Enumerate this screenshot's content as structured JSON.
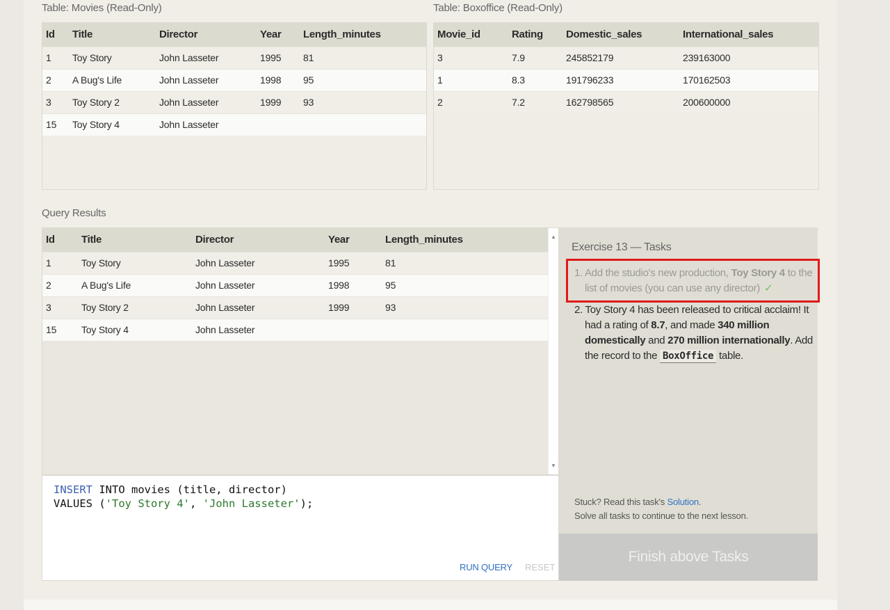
{
  "movies_table": {
    "caption": "Table: Movies (Read-Only)",
    "columns": [
      "Id",
      "Title",
      "Director",
      "Year",
      "Length_minutes"
    ],
    "rows": [
      [
        "1",
        "Toy Story",
        "John Lasseter",
        "1995",
        "81"
      ],
      [
        "2",
        "A Bug's Life",
        "John Lasseter",
        "1998",
        "95"
      ],
      [
        "3",
        "Toy Story 2",
        "John Lasseter",
        "1999",
        "93"
      ],
      [
        "15",
        "Toy Story 4",
        "John Lasseter",
        "",
        ""
      ]
    ]
  },
  "boxoffice_table": {
    "caption": "Table: Boxoffice (Read-Only)",
    "columns": [
      "Movie_id",
      "Rating",
      "Domestic_sales",
      "International_sales"
    ],
    "rows": [
      [
        "3",
        "7.9",
        "245852179",
        "239163000"
      ],
      [
        "1",
        "8.3",
        "191796233",
        "170162503"
      ],
      [
        "2",
        "7.2",
        "162798565",
        "200600000"
      ]
    ]
  },
  "query_results": {
    "caption": "Query Results",
    "columns": [
      "Id",
      "Title",
      "Director",
      "Year",
      "Length_minutes"
    ],
    "rows": [
      [
        "1",
        "Toy Story",
        "John Lasseter",
        "1995",
        "81"
      ],
      [
        "2",
        "A Bug's Life",
        "John Lasseter",
        "1998",
        "95"
      ],
      [
        "3",
        "Toy Story 2",
        "John Lasseter",
        "1999",
        "93"
      ],
      [
        "15",
        "Toy Story 4",
        "John Lasseter",
        "",
        ""
      ]
    ]
  },
  "editor": {
    "line1_kw1": "INSERT",
    "line1_rest": " INTO movies (title, director)",
    "line2_start": "VALUES (",
    "line2_str1": "'Toy Story 4'",
    "line2_mid": ", ",
    "line2_str2": "'John Lasseter'",
    "line2_end": ");",
    "run_label": "RUN QUERY",
    "reset_label": "RESET"
  },
  "tasks": {
    "title": "Exercise 13 — Tasks",
    "task1": {
      "num": "1.",
      "pre": "Add the studio's new production, ",
      "bold": "Toy Story 4",
      "post": " to the list of movies (you can use any director)",
      "check": "✓"
    },
    "task2": {
      "num": "2.",
      "t1": "Toy Story 4 has been released to critical acclaim! It had a rating of ",
      "b1": "8.7",
      "t2": ", and made ",
      "b2": "340 million domestically",
      "t3": " and ",
      "b3": "270 million internationally",
      "t4": ". Add the record to the ",
      "code": "BoxOffice",
      "t5": " table."
    },
    "stuck_pre": "Stuck? Read this task's ",
    "stuck_link": "Solution",
    "stuck_post": ".",
    "solve_all": "Solve all tasks to continue to the next lesson.",
    "finish_label": "Finish above Tasks"
  },
  "colors": {
    "highlight_border": "#e01a1a",
    "link": "#2f6fc1",
    "check": "#6fbf6f"
  }
}
